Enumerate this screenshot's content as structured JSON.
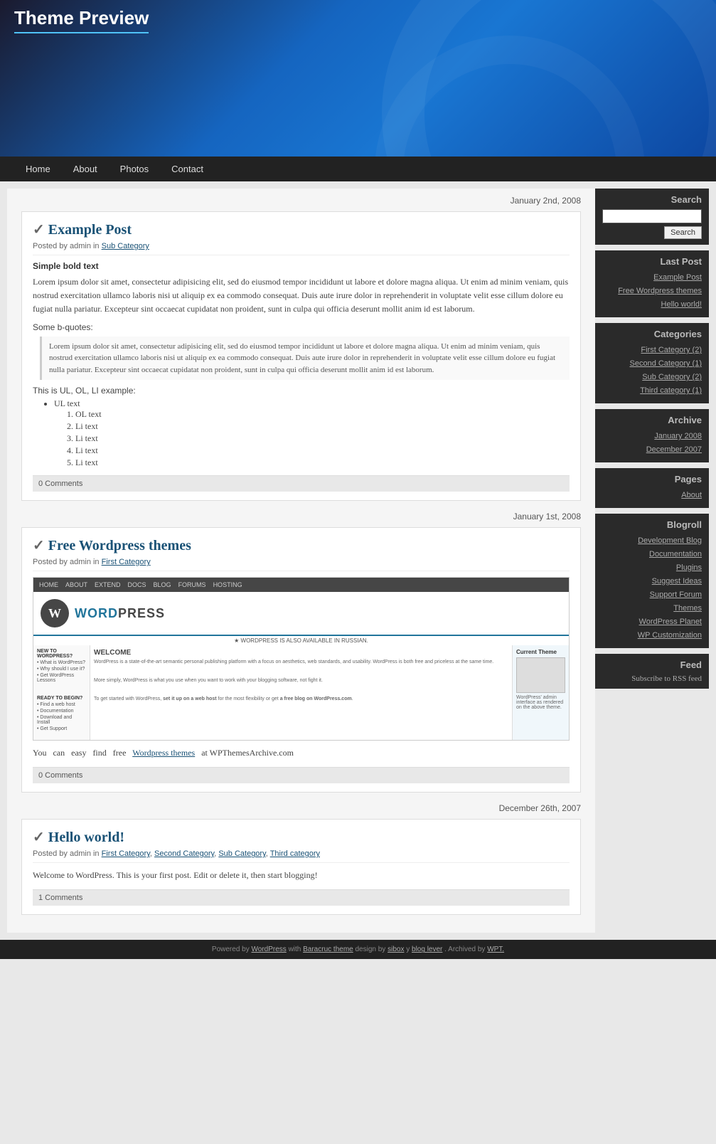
{
  "site": {
    "title": "Theme Preview"
  },
  "nav": {
    "items": [
      "Home",
      "About",
      "Photos",
      "Contact"
    ]
  },
  "sidebar": {
    "search_label": "Search",
    "search_button": "Search",
    "last_post_label": "Last Post",
    "last_posts": [
      {
        "label": "Example Post",
        "url": "#"
      },
      {
        "label": "Free Wordpress themes",
        "url": "#"
      },
      {
        "label": "Hello world!",
        "url": "#"
      }
    ],
    "categories_label": "Categories",
    "categories": [
      {
        "label": "First Category (2)",
        "url": "#"
      },
      {
        "label": "Second Category (1)",
        "url": "#"
      },
      {
        "label": "Sub Category (2)",
        "url": "#"
      },
      {
        "label": "Third category (1)",
        "url": "#"
      }
    ],
    "archive_label": "Archive",
    "archive": [
      {
        "label": "January 2008",
        "url": "#"
      },
      {
        "label": "December 2007",
        "url": "#"
      }
    ],
    "pages_label": "Pages",
    "pages": [
      {
        "label": "About",
        "url": "#"
      }
    ],
    "blogroll_label": "Blogroll",
    "blogroll": [
      {
        "label": "Development Blog",
        "url": "#"
      },
      {
        "label": "Documentation",
        "url": "#"
      },
      {
        "label": "Plugins",
        "url": "#"
      },
      {
        "label": "Suggest Ideas",
        "url": "#"
      },
      {
        "label": "Support Forum",
        "url": "#"
      },
      {
        "label": "Themes",
        "url": "#"
      },
      {
        "label": "WordPress Planet",
        "url": "#"
      },
      {
        "label": "WP Customization",
        "url": "#"
      }
    ],
    "feed_label": "Feed",
    "feed_link": "Subscribe to RSS feed"
  },
  "posts": [
    {
      "date": "January 2nd, 2008",
      "title": "Example Post",
      "meta": "Posted by admin in",
      "category": "Sub Category",
      "bold_text": "Simple bold text",
      "body": "Lorem ipsum dolor sit amet, consectetur adipisicing elit, sed do eiusmod tempor incididunt ut labore et dolore magna aliqua. Ut enim ad minim veniam, quis nostrud exercitation ullamco laboris nisi ut aliquip ex ea commodo consequat. Duis aute irure dolor in reprehenderit in voluptate velit esse cillum dolore eu fugiat nulla pariatur. Excepteur sint occaecat cupidatat non proident, sunt in culpa qui officia deserunt mollit anim id est laborum.",
      "blockquote_label": "Some b-quotes:",
      "blockquote": "Lorem ipsum dolor sit amet, consectetur adipisicing elit, sed do eiusmod tempor incididunt ut labore et dolore magna aliqua. Ut enim ad minim veniam, quis nostrud exercitation ullamco laboris nisi ut aliquip ex ea commodo consequat. Duis aute irure dolor in reprehenderit in voluptate velit esse cillum dolore eu fugiat nulla pariatur. Excepteur sint occaecat cupidatat non proident, sunt in culpa qui officia deserunt mollit anim id est laborum.",
      "list_label": "This is UL, OL, LI example:",
      "ul": [
        "UL text"
      ],
      "ol": [
        "OL text",
        "Li text",
        "Li text",
        "Li text",
        "Li text"
      ],
      "comments": "0 Comments"
    },
    {
      "date": "January 1st, 2008",
      "title": "Free Wordpress themes",
      "meta": "Posted by admin in",
      "category": "First Category",
      "has_screenshot": true,
      "free_text_before": "You   can   easy   find   free",
      "free_link_text": "Wordpress themes",
      "free_text_after": "at WPThemesArchive.com",
      "comments": "0 Comments"
    },
    {
      "date": "December 26th, 2007",
      "title": "Hello world!",
      "meta": "Posted by admin in",
      "categories_multi": "First Category, Second Category, Sub Category, Third category",
      "body": "Welcome to WordPress. This is your first post. Edit or delete it, then start blogging!",
      "comments": "1 Comments"
    }
  ],
  "footer": {
    "text": "Powered by",
    "wp_link": "WordPress",
    "with_text": "with",
    "theme_link": "Baracruc theme",
    "design_text": "design by",
    "sibox_link": "sibox",
    "y_text": "y",
    "blog_link": "blog lever",
    "archived_text": ". Archived by",
    "wpt_link": "WPT."
  }
}
